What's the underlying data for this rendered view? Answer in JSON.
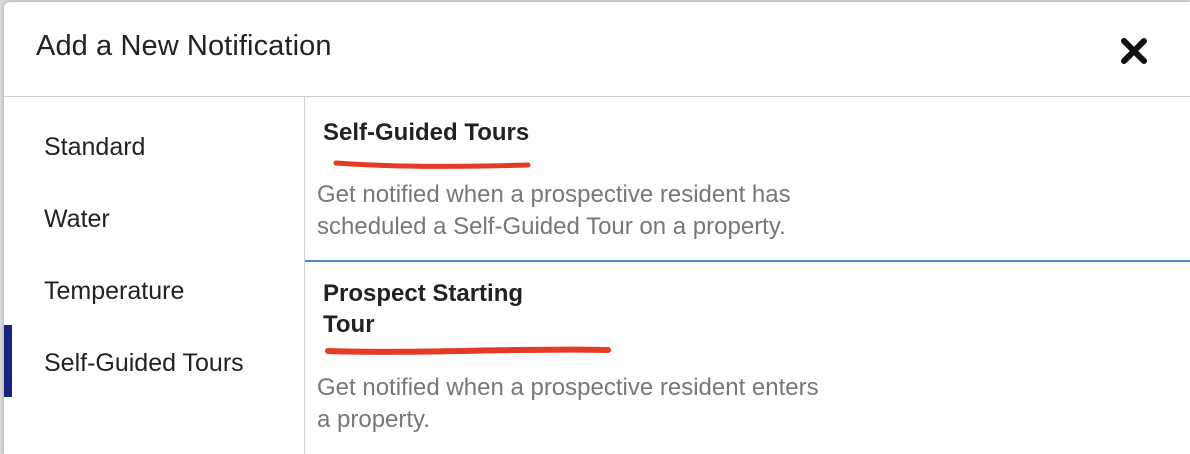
{
  "dialog": {
    "title": "Add a New Notification",
    "close_icon": "close-icon"
  },
  "sidebar": {
    "items": [
      {
        "label": "Standard",
        "active": false
      },
      {
        "label": "Water",
        "active": false
      },
      {
        "label": "Temperature",
        "active": false
      },
      {
        "label": "Self-Guided Tours",
        "active": true
      }
    ],
    "active_indicator_color": "#1a237e"
  },
  "cards": [
    {
      "title_lines": [
        "Self-Guided Tours"
      ],
      "description_lines": [
        "Get notified when a prospective resident has",
        "scheduled a Self-Guided Tour on a property."
      ]
    },
    {
      "title_lines": [
        "Prospect Starting",
        "Tour"
      ],
      "description_lines": [
        "Get notified when a prospective resident enters",
        "a property."
      ]
    }
  ],
  "colors": {
    "annotation_underline": "#e53a23",
    "card_divider": "#4a8cc9",
    "description_text": "#777777"
  }
}
